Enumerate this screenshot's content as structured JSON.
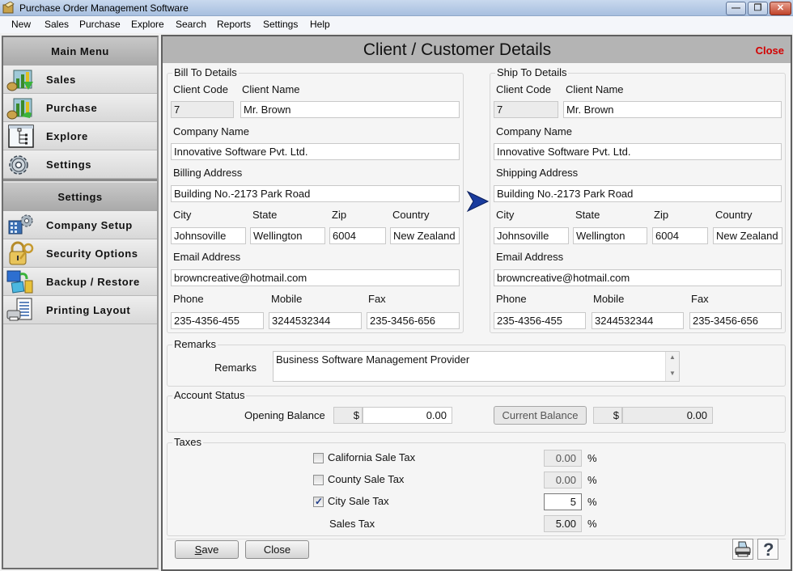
{
  "window": {
    "title": "Purchase Order Management Software",
    "controls": [
      "minimize",
      "restore",
      "close"
    ]
  },
  "menubar": [
    "New",
    "Sales",
    "Purchase",
    "Explore",
    "Search",
    "Reports",
    "Settings",
    "Help"
  ],
  "sidebar": {
    "main_menu_title": "Main Menu",
    "main_items": [
      {
        "label": "Sales",
        "icon": "sales-chart-icon"
      },
      {
        "label": "Purchase",
        "icon": "purchase-chart-icon"
      },
      {
        "label": "Explore",
        "icon": "tree-explorer-icon"
      },
      {
        "label": "Settings",
        "icon": "gear-icon"
      }
    ],
    "settings_title": "Settings",
    "settings_items": [
      {
        "label": "Company Setup",
        "icon": "building-gear-icon"
      },
      {
        "label": "Security Options",
        "icon": "padlock-key-icon"
      },
      {
        "label": "Backup / Restore",
        "icon": "backup-icon"
      },
      {
        "label": "Printing Layout",
        "icon": "printer-document-icon"
      }
    ]
  },
  "main": {
    "title": "Client / Customer Details",
    "close_label": "Close",
    "bill_to": {
      "legend": "Bill To Details",
      "client_code_label": "Client Code",
      "client_name_label": "Client Name",
      "client_code": "7",
      "client_name": "Mr. Brown",
      "company_name_label": "Company Name",
      "company_name": "Innovative Software Pvt. Ltd.",
      "address_label": "Billing Address",
      "address": "Building No.-2173 Park Road",
      "city_label": "City",
      "state_label": "State",
      "zip_label": "Zip",
      "country_label": "Country",
      "city": "Johnsoville",
      "state": "Wellington",
      "zip": "6004",
      "country": "New Zealand",
      "email_label": "Email Address",
      "email": "browncreative@hotmail.com",
      "phone_label": "Phone",
      "mobile_label": "Mobile",
      "fax_label": "Fax",
      "phone": "235-4356-455",
      "mobile": "3244532344",
      "fax": "235-3456-656"
    },
    "ship_to": {
      "legend": "Ship To Details",
      "client_code_label": "Client Code",
      "client_name_label": "Client Name",
      "client_code": "7",
      "client_name": "Mr. Brown",
      "company_name_label": "Company Name",
      "company_name": "Innovative Software Pvt. Ltd.",
      "address_label": "Shipping Address",
      "address": "Building No.-2173 Park Road",
      "city_label": "City",
      "state_label": "State",
      "zip_label": "Zip",
      "country_label": "Country",
      "city": "Johnsoville",
      "state": "Wellington",
      "zip": "6004",
      "country": "New Zealand",
      "email_label": "Email Address",
      "email": "browncreative@hotmail.com",
      "phone_label": "Phone",
      "mobile_label": "Mobile",
      "fax_label": "Fax",
      "phone": "235-4356-455",
      "mobile": "3244532344",
      "fax": "235-3456-656"
    },
    "copy_arrow_icon": "copy-to-ship-arrow-icon",
    "remarks": {
      "legend": "Remarks",
      "label": "Remarks",
      "value": "Business Software Management Provider"
    },
    "account_status": {
      "legend": "Account Status",
      "opening_balance_label": "Opening Balance",
      "currency_symbol": "$",
      "opening_balance": "0.00",
      "current_balance_button": "Current Balance",
      "current_balance": "0.00"
    },
    "taxes": {
      "legend": "Taxes",
      "items": [
        {
          "label": "California Sale Tax",
          "checked": false,
          "value": "0.00"
        },
        {
          "label": "County Sale Tax",
          "checked": false,
          "value": "0.00"
        },
        {
          "label": "City Sale Tax",
          "checked": true,
          "value": "5"
        }
      ],
      "sales_tax_label": "Sales Tax",
      "sales_tax_value": "5.00",
      "percent_symbol": "%"
    },
    "footer": {
      "save_label": "Save",
      "close_label": "Close"
    }
  }
}
